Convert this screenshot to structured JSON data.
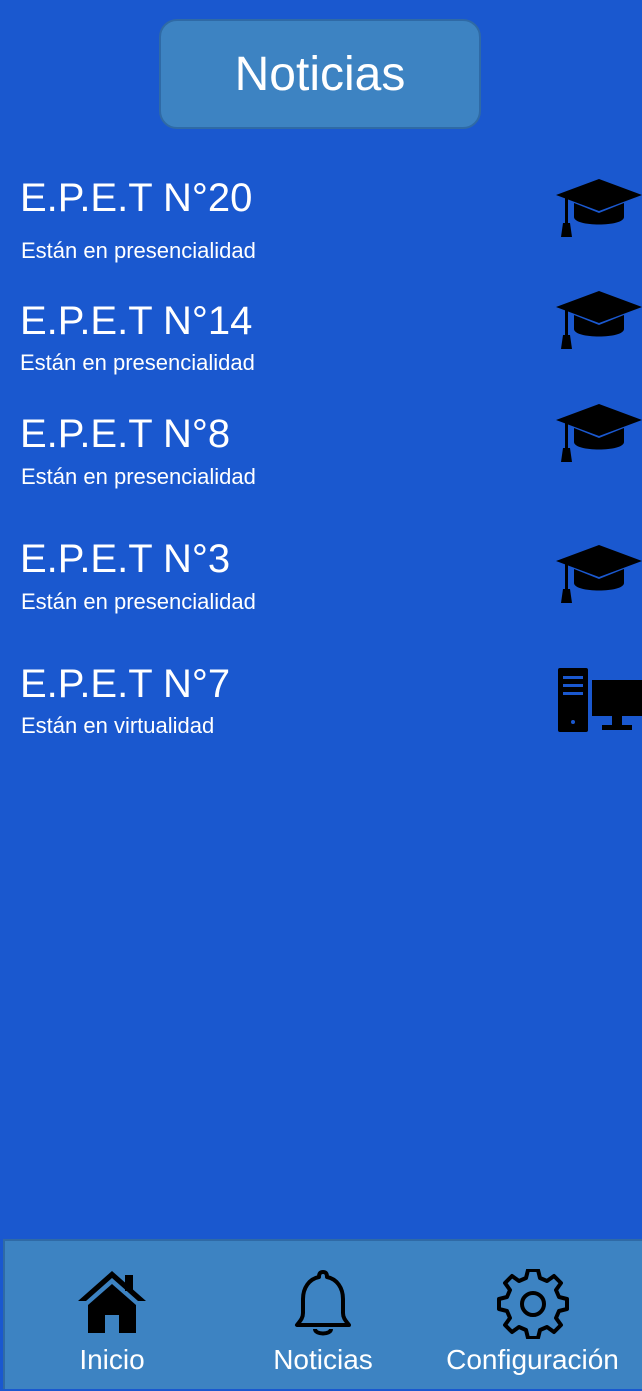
{
  "header": {
    "title": "Noticias"
  },
  "news": [
    {
      "title": "E.P.E.T N°20",
      "subtitle": "Están en presencialidad",
      "icon": "graduation-cap-icon"
    },
    {
      "title": "E.P.E.T N°14",
      "subtitle": "Están en presencialidad",
      "icon": "graduation-cap-icon"
    },
    {
      "title": "E.P.E.T N°8",
      "subtitle": "Están en presencialidad",
      "icon": "graduation-cap-icon"
    },
    {
      "title": "E.P.E.T N°3",
      "subtitle": "Están en presencialidad",
      "icon": "graduation-cap-icon"
    },
    {
      "title": "E.P.E.T N°7",
      "subtitle": "Están en virtualidad",
      "icon": "desktop-computer-icon"
    }
  ],
  "nav": {
    "items": [
      {
        "label": "Inicio",
        "icon": "home-icon"
      },
      {
        "label": "Noticias",
        "icon": "bell-icon"
      },
      {
        "label": "Configuración",
        "icon": "gear-icon"
      }
    ]
  },
  "colors": {
    "background": "#1a58cf",
    "panel": "#3d83c2",
    "text": "#ffffff",
    "icon": "#000000"
  }
}
